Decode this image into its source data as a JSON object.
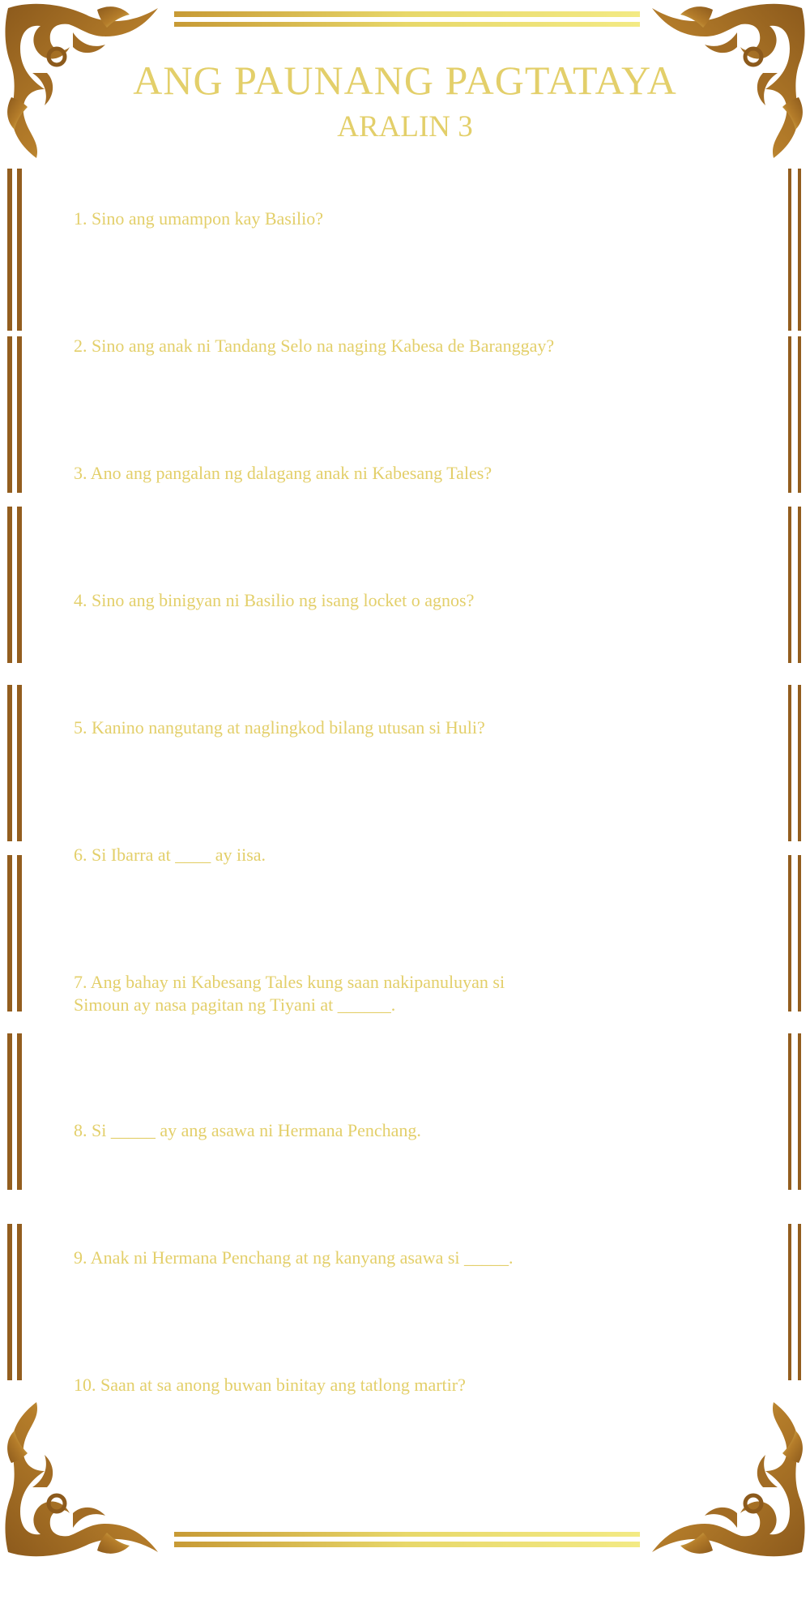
{
  "header": {
    "title": "ANG PAUNANG PAGTATAYA",
    "subtitle": "ARALIN 3"
  },
  "questions": [
    "1. Sino ang umampon kay Basilio?",
    "2. Sino ang anak ni Tandang Selo na naging Kabesa de Baranggay?",
    "3. Ano ang pangalan ng dalagang anak ni Kabesang Tales?",
    "4. Sino ang binigyan ni Basilio ng isang locket o agnos?",
    "5. Kanino nangutang at naglingkod bilang utusan si Huli?",
    "6. Si Ibarra at ____ ay iisa.",
    "7. Ang bahay ni Kabesang Tales kung saan nakipanuluyan si\n Simoun ay nasa pagitan ng Tiyani at ______.",
    "8. Si _____ ay ang asawa ni Hermana Penchang.",
    "9. Anak ni Hermana Penchang at ng kanyang asawa si _____.",
    "10. Saan at sa anong buwan binitay ang tatlong martir?"
  ],
  "colors": {
    "text_gold": "#e3cf6a",
    "frame_brown": "#935e1f",
    "frame_light_gold": "#ede27c"
  },
  "icons": [
    "ornate-corner-icon"
  ]
}
